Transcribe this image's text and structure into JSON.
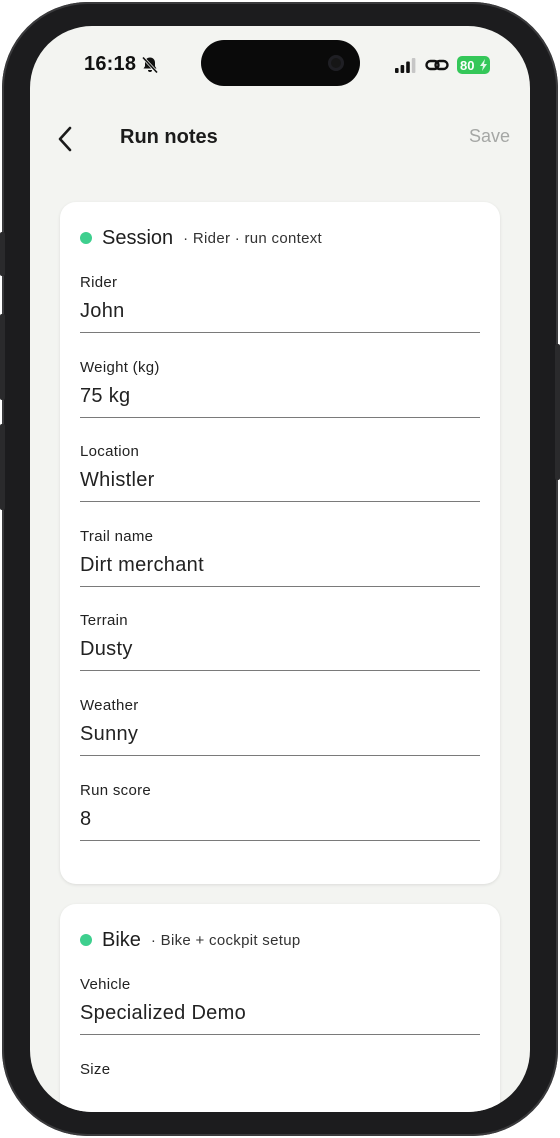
{
  "status": {
    "time": "16:18",
    "battery": "80"
  },
  "nav": {
    "title": "Run notes",
    "save_label": "Save"
  },
  "session": {
    "title": "Session",
    "subtitle": "· Rider · run context",
    "fields": [
      {
        "label": "Rider",
        "value": "John"
      },
      {
        "label": "Weight (kg)",
        "value": "75 kg"
      },
      {
        "label": "Location",
        "value": "Whistler"
      },
      {
        "label": "Trail name",
        "value": "Dirt merchant"
      },
      {
        "label": "Terrain",
        "value": "Dusty"
      },
      {
        "label": "Weather",
        "value": "Sunny"
      },
      {
        "label": "Run score",
        "value": "8"
      }
    ]
  },
  "bike": {
    "title": "Bike",
    "subtitle": "· Bike + cockpit setup",
    "fields": [
      {
        "label": "Vehicle",
        "value": "Specialized Demo"
      },
      {
        "label": "Size",
        "value": ""
      }
    ]
  },
  "colors": {
    "accent_dot": "#3ecf8e",
    "battery": "#34c759",
    "background": "#f3f4f1"
  }
}
